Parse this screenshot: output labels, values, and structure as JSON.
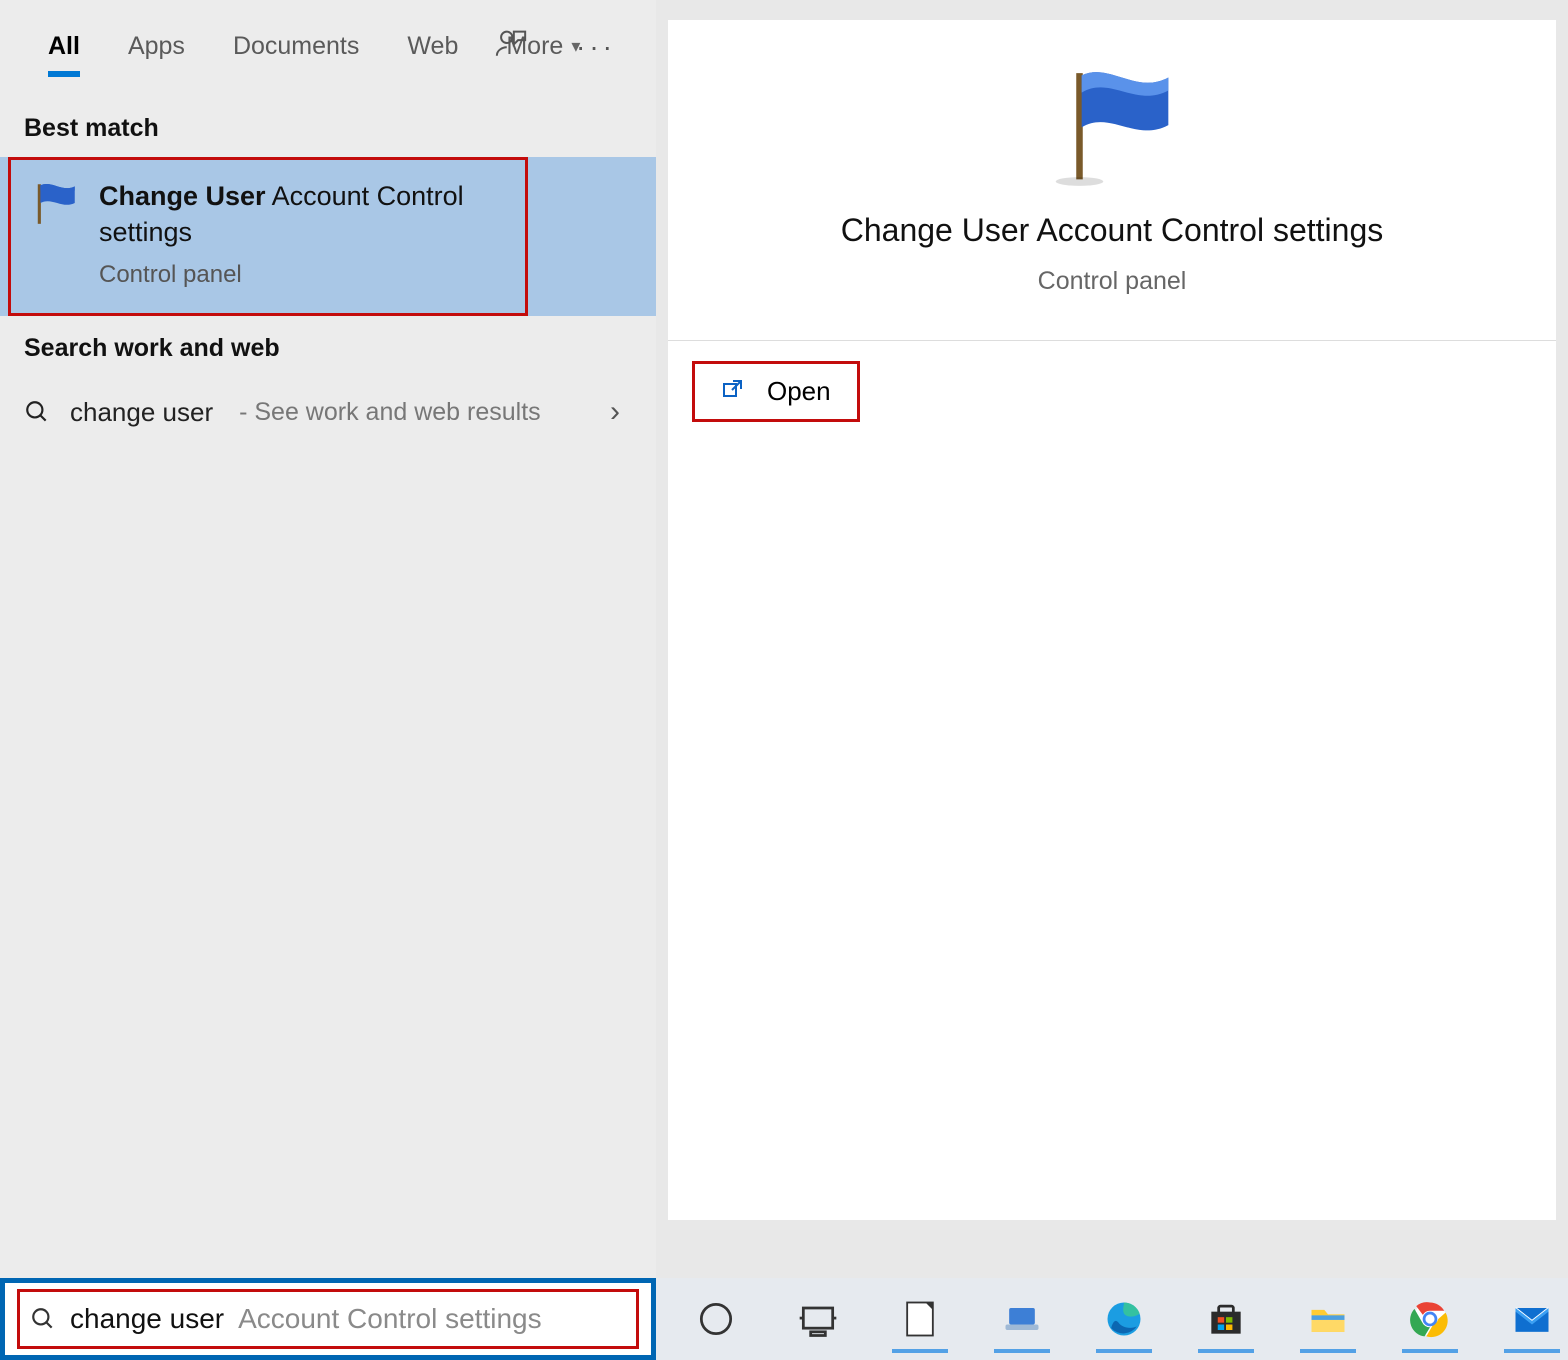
{
  "tabs": {
    "all": "All",
    "apps": "Apps",
    "documents": "Documents",
    "web": "Web",
    "more": "More"
  },
  "section_best_match": "Best match",
  "best_match": {
    "title_bold": "Change User",
    "title_rest": " Account Control settings",
    "subtitle": "Control panel"
  },
  "section_search_web": "Search work and web",
  "web_result": {
    "query": "change user",
    "hint": "- See work and web results"
  },
  "preview": {
    "title": "Change User Account Control settings",
    "subtitle": "Control panel",
    "open_label": "Open"
  },
  "search_box": {
    "typed": "change user",
    "ghost": " Account Control settings"
  },
  "taskbar_icons": [
    "cortana",
    "task-view",
    "libreoffice",
    "laptop",
    "edge",
    "microsoft-store",
    "file-explorer",
    "chrome",
    "mail"
  ]
}
